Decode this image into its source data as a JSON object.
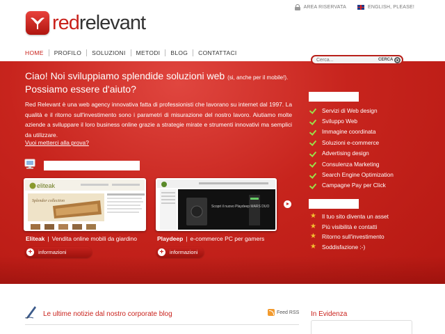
{
  "brand": {
    "name_red": "red",
    "name_dark": "relevant"
  },
  "topbar": {
    "area": "AREA RISERVATA",
    "lang": "ENGLISH, PLEASE!"
  },
  "nav": [
    "HOME",
    "PROFILO",
    "SOLUZIONI",
    "METODI",
    "BLOG",
    "CONTATTACI"
  ],
  "search": {
    "placeholder": "Cerca...",
    "button": "CERCA"
  },
  "hero": {
    "headline_1": "Ciao! Noi sviluppiamo splendide soluzioni web",
    "headline_small": "(si, anche per il mobile!).",
    "headline_2": "Possiamo essere d'aiuto?",
    "intro": "Red Relevant è una web agency innovativa fatta di professionisti che lavorano su internet dal 1997. La qualità e il ritorno sull'investimento sono i parametri di misurazione del nostro lavoro. Aiutiamo molte aziende a sviluppare il loro business online grazie a strategie mirate e strumenti innovativi ma semplici da utilizzare.",
    "cta": "Vuoi metterci alla prova?"
  },
  "portfolio": [
    {
      "name": "Eliteak",
      "desc": "Vendita online mobili da giardino",
      "button": "informazioni",
      "thumb_logo": "eliteak",
      "thumb_tag": "Splendor collection"
    },
    {
      "name": "Playdeep",
      "desc": "e-commerce PC per gamers",
      "button": "informazioni",
      "thumb_text": "Scopri il nuovo Playdeep MARS DUO"
    }
  ],
  "services": [
    "Servizi di Web design",
    "Sviluppo Web",
    "Immagine coordinata",
    "Soluzioni e-commerce",
    "Advertising design",
    "Consulenza Marketing",
    "Search Engine Optimization",
    "Campagne Pay per Click"
  ],
  "benefits": [
    "Il tuo sito diventa un asset",
    "Più visibilità e contatti",
    "Ritorno sull'investimento",
    "Soddisfazione :-)"
  ],
  "blog": {
    "title": "Le ultime notizie dal nostro corporate blog",
    "rss": "Feed RSS"
  },
  "evidenza": {
    "title": "In Evidenza"
  },
  "colors": {
    "brand_red": "#c9221c",
    "check_green": "#9be04a",
    "star_yellow": "#f4c030"
  }
}
